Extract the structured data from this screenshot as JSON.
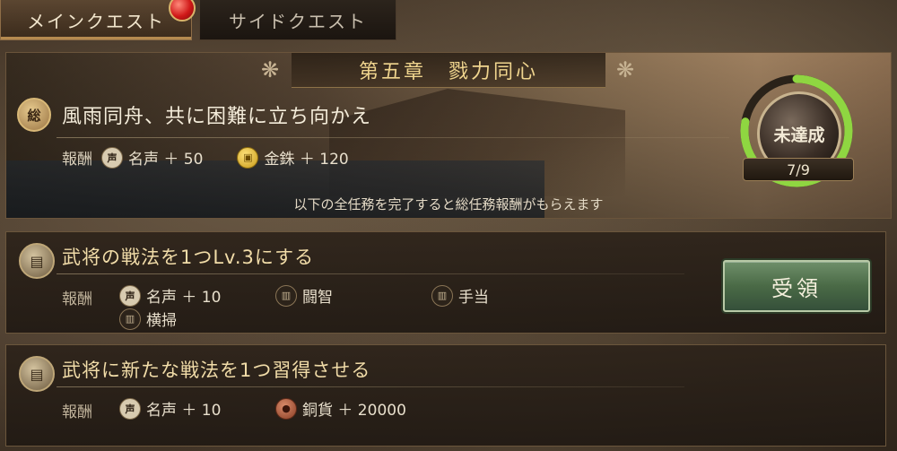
{
  "tabs": {
    "main": "メインクエスト",
    "side": "サイドクエスト"
  },
  "chapter": {
    "title": "第五章　戮力同心",
    "badge": "総",
    "task": "風雨同舟、共に困難に立ち向かえ",
    "reward_label": "報酬",
    "rewards": [
      {
        "icon": "声",
        "text": "名声 ＋ 50"
      },
      {
        "icon": "金",
        "text": "金銖 ＋ 120"
      }
    ],
    "note": "以下の全任務を完了すると総任務報酬がもらえます",
    "status": "未達成",
    "progress_text": "7/9",
    "progress_done": 7,
    "progress_total": 9
  },
  "quests": [
    {
      "title": "武将の戦法を1つLv.3にする",
      "reward_label": "報酬",
      "rewards": [
        {
          "icon": "声",
          "text": "名声 ＋ 10"
        },
        {
          "icon": "書",
          "text": "闘智"
        },
        {
          "icon": "書",
          "text": "手当"
        },
        {
          "icon": "書",
          "text": "横掃"
        }
      ],
      "button": "受領"
    },
    {
      "title": "武将に新たな戦法を1つ習得させる",
      "reward_label": "報酬",
      "rewards": [
        {
          "icon": "声",
          "text": "名声 ＋ 10"
        },
        {
          "icon": "銅",
          "text": "銅貨 ＋ 20000"
        }
      ]
    }
  ],
  "colors": {
    "ring_progress": "#8fd641",
    "button_green": "#4a6a46",
    "title_gold": "#f0d58e"
  }
}
